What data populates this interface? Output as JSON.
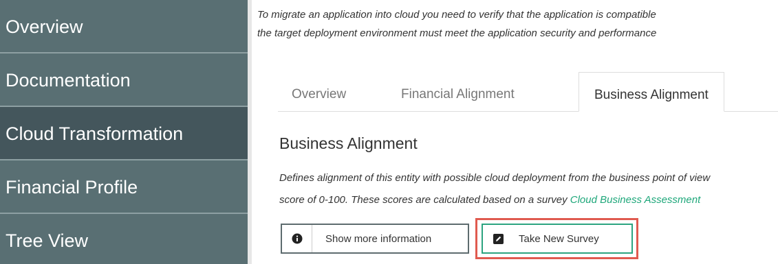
{
  "sidebar": {
    "items": [
      {
        "label": "Overview",
        "active": false
      },
      {
        "label": "Documentation",
        "active": false
      },
      {
        "label": "Cloud Transformation",
        "active": true
      },
      {
        "label": "Financial Profile",
        "active": false
      },
      {
        "label": "Tree View",
        "active": false
      }
    ]
  },
  "intro": {
    "line1": "To migrate an application into cloud you need to verify that the application is compatible",
    "line2": "the target deployment environment must meet the application security and performance"
  },
  "tabs": [
    {
      "label": "Overview",
      "active": false
    },
    {
      "label": "Financial Alignment",
      "active": false
    },
    {
      "label": "Business Alignment",
      "active": true
    }
  ],
  "section": {
    "title": "Business Alignment",
    "desc_line1": "Defines alignment of this entity with possible cloud deployment from the business point of view",
    "desc_line2_prefix": "score of 0-100. These scores are calculated based on a survey ",
    "desc_link": "Cloud Business Assessment"
  },
  "buttons": {
    "info_label": "Show more information",
    "info_icon": "info-icon",
    "survey_label": "Take New Survey",
    "survey_icon": "edit-icon"
  },
  "colors": {
    "sidebar_bg": "#596f73",
    "sidebar_active_bg": "#44565c",
    "link": "#1ea77a",
    "survey_border": "#2ba37f",
    "highlight": "#e05a4f"
  }
}
